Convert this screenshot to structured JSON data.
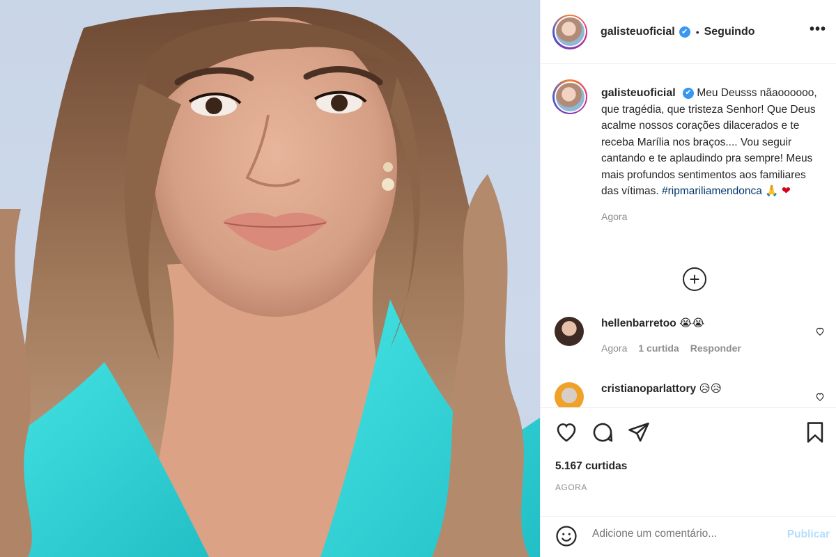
{
  "post": {
    "username": "galisteuoficial",
    "verified_badge": "✔",
    "separator": "•",
    "follow_state": "Seguindo",
    "more_icon": "•••",
    "caption": "Meu Deusss nãaoooooo, que tragédia, que tristeza Senhor! Que Deus acalme nossos corações dilacerados e te receba Marília nos braços.... Vou seguir cantando e te aplaudindo pra sempre! Meus mais profundos sentimentos aos familiares das vítimas.",
    "hashtag": "#ripmariliamendonca",
    "emoji_pray": "🙏",
    "emoji_heart": "❤",
    "caption_time": "Agora",
    "load_more_icon": "+"
  },
  "comments": [
    {
      "username": "hellenbarretoo",
      "text": "😭😭",
      "time": "Agora",
      "likes": "1 curtida",
      "reply": "Responder"
    },
    {
      "username": "cristianoparlattory",
      "text": "😥😥"
    }
  ],
  "actions": {
    "likes_count": "5.167 curtidas",
    "time_upper": "AGORA",
    "comment_placeholder": "Adicione um comentário...",
    "publish": "Publicar"
  },
  "icons": [
    "heart-icon",
    "comment-icon",
    "share-icon",
    "bookmark-icon",
    "emoji-icon",
    "verified-icon",
    "more-icon",
    "plus-circle-icon"
  ],
  "colors": {
    "accent": "#3897f0",
    "hashtag": "#00376b",
    "publish_disabled": "#b2dffc",
    "muted": "#8e8e8e",
    "outfit": "#2ed3d6"
  }
}
